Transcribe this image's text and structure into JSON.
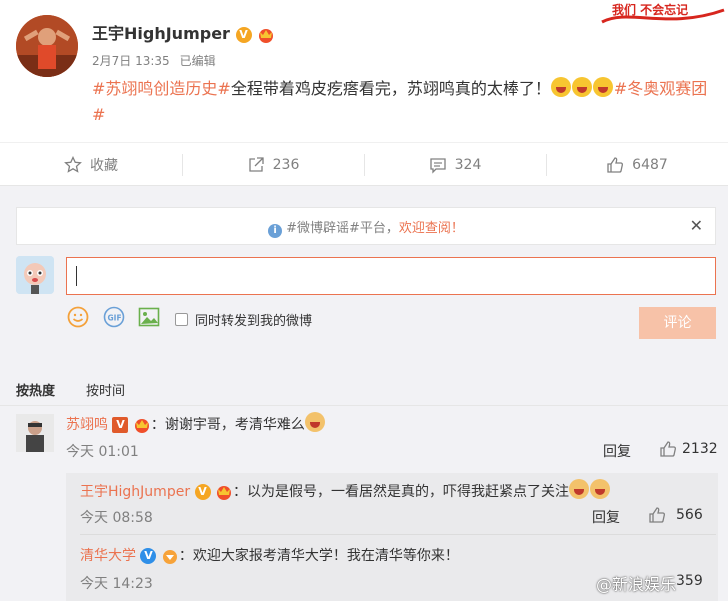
{
  "post": {
    "author": "王宇HighJumper",
    "date": "2月7日 13:35",
    "edited": "已编辑",
    "hashtag1": "#苏翊鸣创造历史#",
    "text": "全程带着鸡皮疙瘩看完，苏翊鸣真的太棒了！",
    "hashtag2": "#冬奥观赛团#",
    "stamp": "我们 不会忘记"
  },
  "actions": {
    "favorite": "收藏",
    "repost": "236",
    "comment": "324",
    "like": "6487"
  },
  "notice": {
    "prefix": "#微博辟谣#平台，",
    "link": "欢迎查阅！"
  },
  "composer": {
    "repost_label": "同时转发到我的微博",
    "submit": "评论"
  },
  "sort": {
    "hot": "按热度",
    "time": "按时间"
  },
  "comments": [
    {
      "name": "苏翊鸣",
      "text": "：谢谢宇哥，考清华难么",
      "time": "今天 01:01",
      "reply": "回复",
      "likes": "2132"
    }
  ],
  "replies": [
    {
      "name": "王宇HighJumper",
      "text": "：以为是假号，一看居然是真的，吓得我赶紧点了关注",
      "time": "今天 08:58",
      "reply": "回复",
      "likes": "566"
    },
    {
      "name": "清华大学",
      "text": "：欢迎大家报考清华大学！我在清华等你来！",
      "time": "今天 14:23",
      "likes": "359"
    }
  ],
  "watermark": "@新浪娱乐",
  "colors": {
    "accent": "#eb7350",
    "muted": "#808080",
    "panel": "#f2f2f5"
  }
}
